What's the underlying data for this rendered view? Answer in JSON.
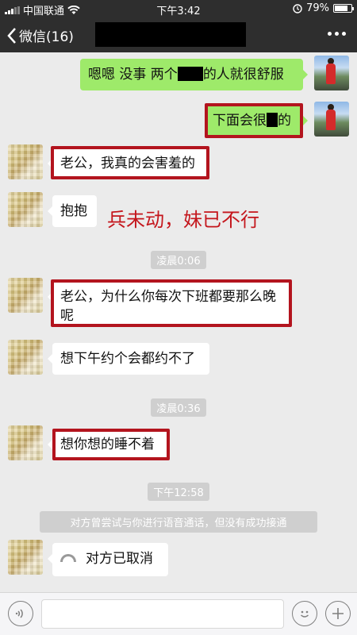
{
  "status_bar": {
    "carrier": "中国联通",
    "time": "下午3:42",
    "battery": "79%",
    "battery_level": 0.79
  },
  "nav": {
    "back_label": "微信(16)"
  },
  "messages": [
    {
      "side": "right",
      "text_before": "嗯嗯 没事 两个",
      "text_after": "的人就很舒服"
    },
    {
      "side": "right",
      "text_before": "下面会很",
      "text_after": "的"
    },
    {
      "side": "left",
      "text": "老公，我真的会害羞的"
    },
    {
      "side": "left",
      "text": "抱抱"
    },
    {
      "side": "left",
      "text": "老公，为什么你每次下班都要那么晚呢"
    },
    {
      "side": "left",
      "text": "想下午约个会都约不了"
    },
    {
      "side": "left",
      "text": "想你想的睡不着"
    },
    {
      "side": "left",
      "text": "对方已取消",
      "type": "call"
    }
  ],
  "timestamps": [
    "凌晨0:06",
    "凌晨0:36",
    "下午12:58"
  ],
  "annotation": "兵未动，妹已不行",
  "system_message": "对方曾尝试与你进行语音通话，但没有成功接通",
  "icons": [
    "back-chevron-icon",
    "more-icon",
    "voice-icon",
    "emoji-icon",
    "plus-icon",
    "phone-hangup-icon",
    "wifi-icon",
    "signal-icon",
    "battery-icon",
    "alarm-icon"
  ],
  "colors": {
    "self_bubble": "#9eea6a",
    "other_bubble": "#ffffff",
    "highlight": "#b3141e",
    "annotation": "#c4161c",
    "header": "#2e2e2e"
  }
}
